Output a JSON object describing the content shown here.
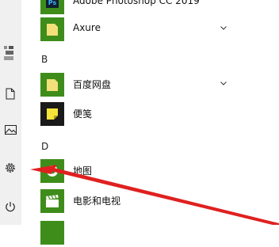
{
  "apps": [
    {
      "label": "Adobe Photoshop CC 2019",
      "icon": "photoshop-icon"
    },
    {
      "label": "Axure",
      "icon": "folder-icon",
      "expandable": true
    },
    {
      "label": "百度网盘",
      "icon": "folder-icon",
      "expandable": true
    },
    {
      "label": "便笺",
      "icon": "sticky-notes-icon"
    },
    {
      "label": "地图",
      "icon": "maps-icon"
    },
    {
      "label": "电影和电视",
      "icon": "clapperboard-icon"
    }
  ],
  "section_letters": {
    "b": "B",
    "d": "D"
  },
  "photoshop_tile_text": "Ps",
  "colors": {
    "tile_green": "#3e8d1b",
    "folder_yellow": "#f4e07a",
    "arrow_red": "#e02020",
    "rail": "#f0f0f0"
  }
}
